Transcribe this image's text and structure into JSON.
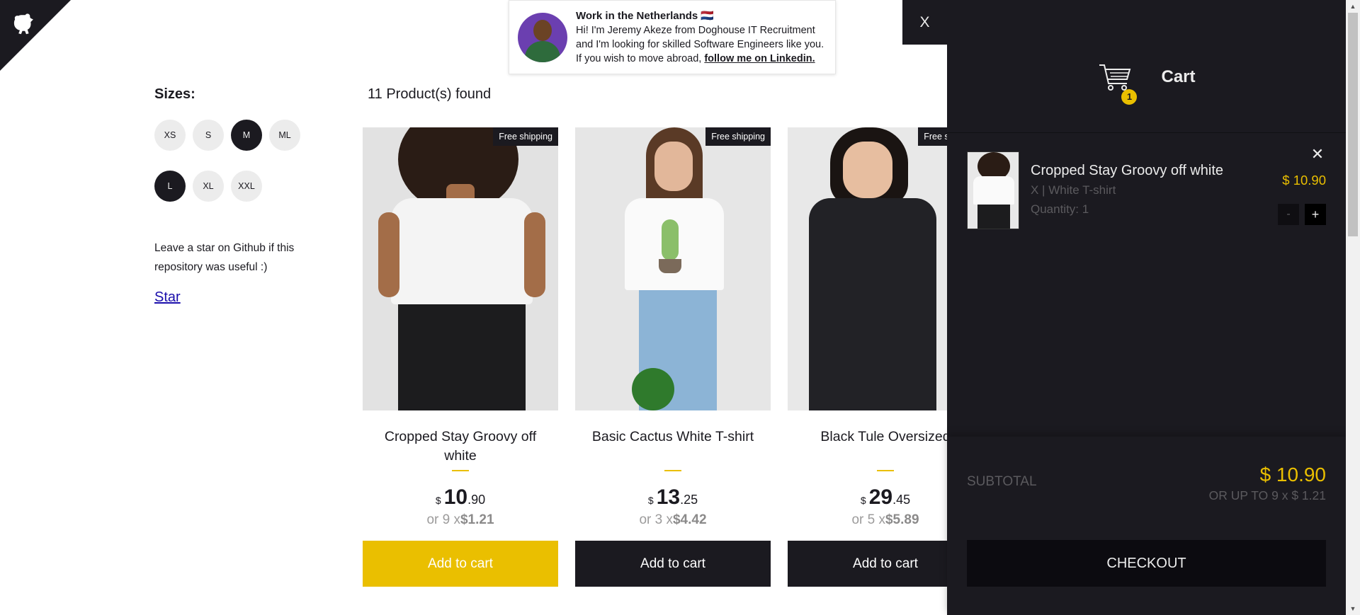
{
  "promo": {
    "title": "Work in the Netherlands 🇳🇱",
    "line1": "Hi! I'm Jeremy Akeze from Doghouse IT Recruitment",
    "line2": "and I'm looking for skilled Software Engineers like you.",
    "line3_prefix": "If you wish to move abroad, ",
    "link": "follow me on Linkedin."
  },
  "filters": {
    "heading": "Sizes:",
    "sizes": [
      {
        "label": "XS",
        "active": false
      },
      {
        "label": "S",
        "active": false
      },
      {
        "label": "M",
        "active": true
      },
      {
        "label": "ML",
        "active": false
      },
      {
        "label": "L",
        "active": true
      },
      {
        "label": "XL",
        "active": false
      },
      {
        "label": "XXL",
        "active": false
      }
    ],
    "star_note": "Leave a star on Github if this repository was useful :)",
    "star_link": "Star"
  },
  "products_found": "11 Product(s) found",
  "products": [
    {
      "title": "Cropped Stay Groovy off white",
      "badge": "Free shipping",
      "currency": "$",
      "price_int": "10",
      "price_dec": ".90",
      "install_prefix": "or 9 x",
      "install_value": "$1.21",
      "button": "Add to cart"
    },
    {
      "title": "Basic Cactus White T-shirt",
      "badge": "Free shipping",
      "currency": "$",
      "price_int": "13",
      "price_dec": ".25",
      "install_prefix": "or 3 x",
      "install_value": "$4.42",
      "button": "Add to cart"
    },
    {
      "title": "Black Tule Oversized",
      "badge": "Free shipping",
      "currency": "$",
      "price_int": "29",
      "price_dec": ".45",
      "install_prefix": "or 5 x",
      "install_value": "$5.89",
      "button": "Add to cart"
    }
  ],
  "cart": {
    "close_label": "X",
    "title": "Cart",
    "count": "1",
    "item": {
      "title": "Cropped Stay Groovy off white",
      "desc": "X | White T-shirt",
      "qty": "Quantity: 1",
      "price": "$ 10.90",
      "remove": "✕",
      "minus": "-",
      "plus": "+"
    },
    "subtotal_label": "SUBTOTAL",
    "subtotal_value": "$ 10.90",
    "subtotal_install": "OR UP TO 9 x $ 1.21",
    "checkout": "CHECKOUT"
  },
  "colors": {
    "accent": "#eabf00",
    "dark": "#1b1a20",
    "light_bg": "#ececec"
  },
  "icons": {
    "github": "github-octocat-icon",
    "cart": "shopping-cart-icon",
    "remove": "close-icon"
  }
}
